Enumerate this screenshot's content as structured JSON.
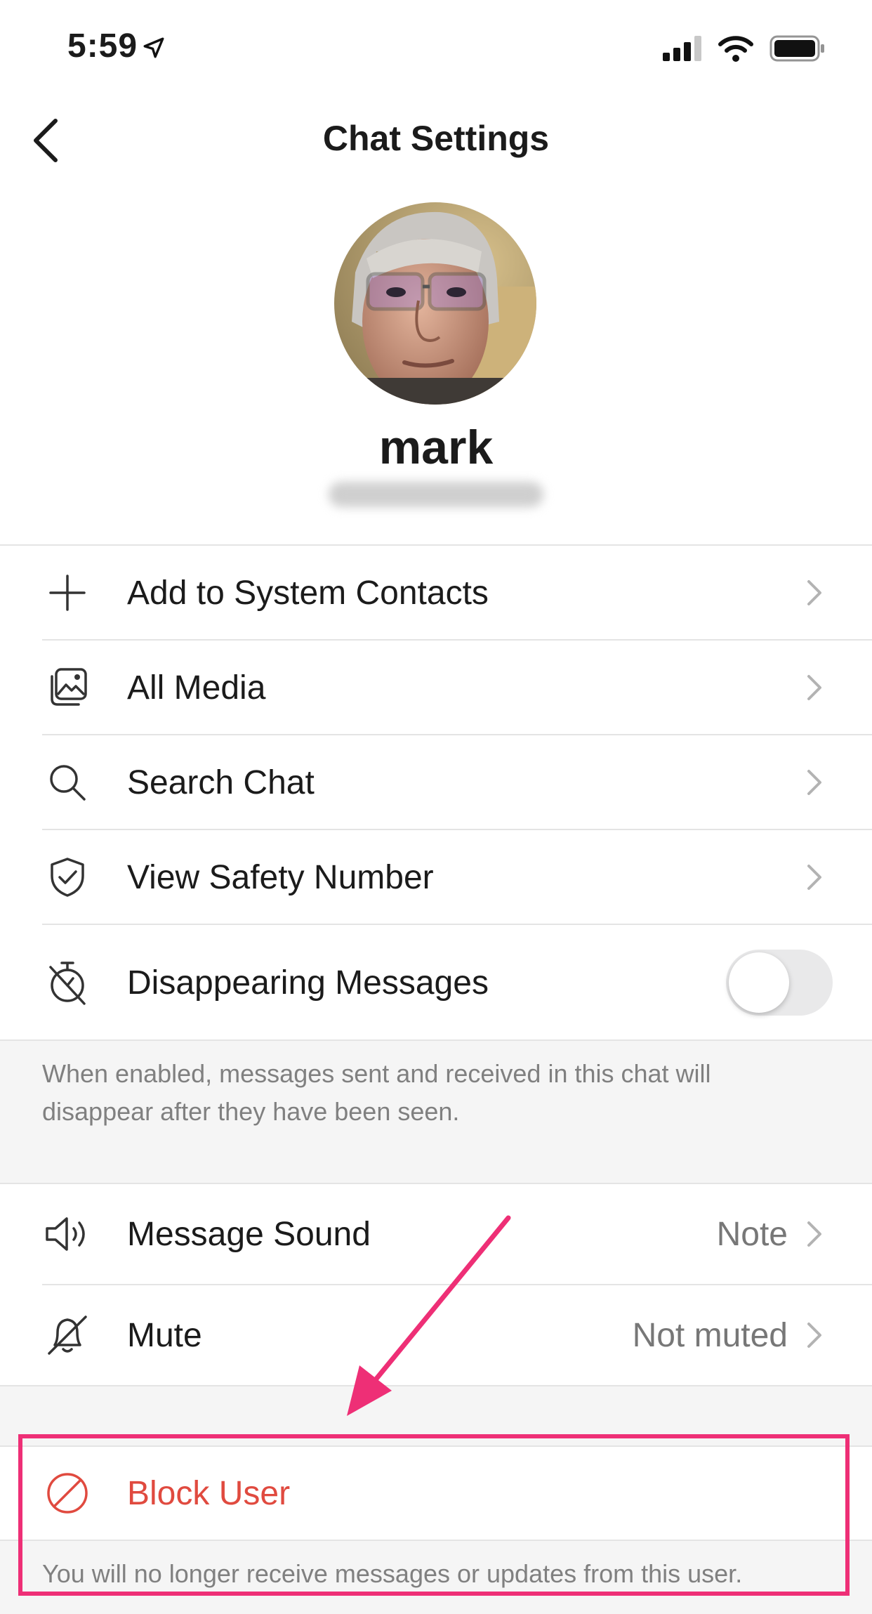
{
  "status_bar": {
    "time": "5:59"
  },
  "nav": {
    "title": "Chat Settings"
  },
  "profile": {
    "name": "mark"
  },
  "menu": [
    {
      "label": "Add to System Contacts",
      "icon": "plus-icon"
    },
    {
      "label": "All Media",
      "icon": "media-gallery-icon"
    },
    {
      "label": "Search Chat",
      "icon": "search-icon"
    },
    {
      "label": "View Safety Number",
      "icon": "shield-check-icon"
    }
  ],
  "disappearing": {
    "label": "Disappearing Messages",
    "icon": "timer-icon",
    "enabled": false,
    "footnote": "When enabled, messages sent and received in this chat will disappear after they have been seen."
  },
  "sound": {
    "label": "Message Sound",
    "value": "Note",
    "icon": "speaker-icon"
  },
  "mute": {
    "label": "Mute",
    "value": "Not muted",
    "icon": "bell-slash-icon"
  },
  "block": {
    "label": "Block User",
    "icon": "block-icon",
    "footnote": "You will no longer receive messages or updates from this user."
  },
  "colors": {
    "danger": "#e04a3f",
    "annotation": "#ee2f76"
  }
}
